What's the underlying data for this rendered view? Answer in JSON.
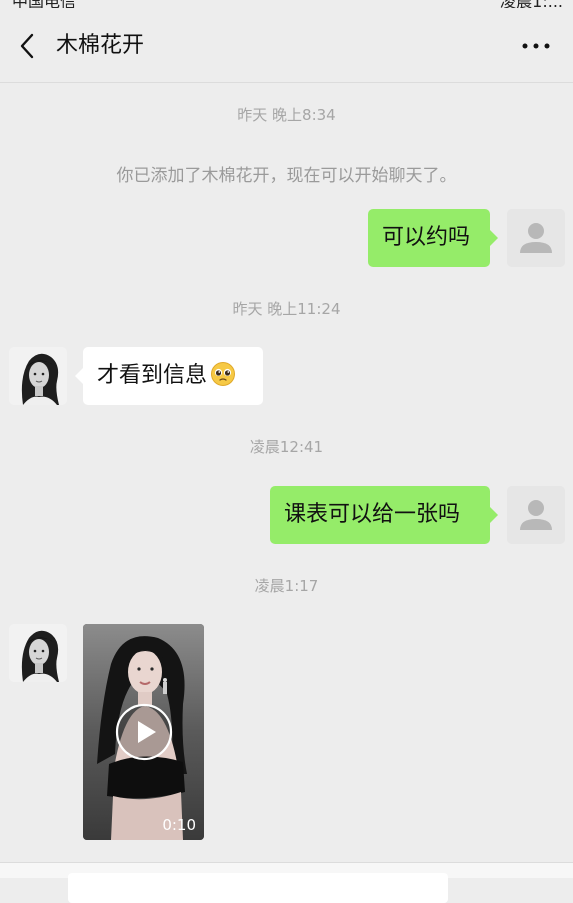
{
  "status_bar": {
    "carrier": "中国电信",
    "time": "凌晨1:..."
  },
  "header": {
    "title": "木棉花开"
  },
  "messages": {
    "ts1": "昨天 晚上8:34",
    "system": "你已添加了木棉花开，现在可以开始聊天了。",
    "out1": "可以约吗",
    "ts2": "昨天 晚上11:24",
    "in1": "才看到信息",
    "ts3": "凌晨12:41",
    "out2": "课表可以给一张吗",
    "ts4": "凌晨1:17",
    "video_duration": "0:10"
  },
  "colors": {
    "background": "#ededed",
    "outgoing_bubble": "#95ec69",
    "incoming_bubble": "#ffffff",
    "timestamp_text": "#a6a6a6"
  },
  "icons": {
    "back": "chevron-left-icon",
    "more": "more-dots-icon",
    "play": "play-icon",
    "emoji": "pleading-face-emoji"
  }
}
